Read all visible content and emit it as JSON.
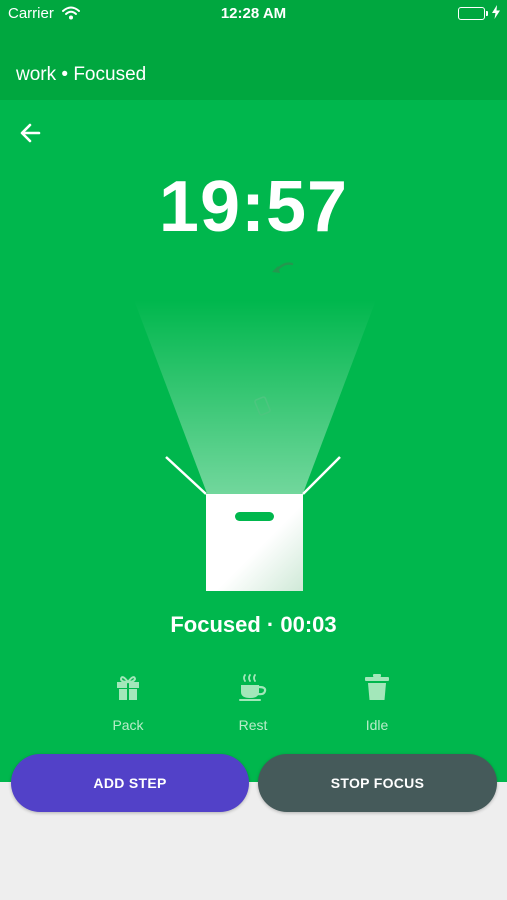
{
  "status_bar": {
    "carrier": "Carrier",
    "time": "12:28 AM"
  },
  "header": {
    "title": "work • Focused"
  },
  "timer": {
    "display": "19:57"
  },
  "session": {
    "status": "Focused · 00:03"
  },
  "actions": [
    {
      "label": "Pack",
      "icon": "gift-icon"
    },
    {
      "label": "Rest",
      "icon": "coffee-cup-icon"
    },
    {
      "label": "Idle",
      "icon": "trash-icon"
    }
  ],
  "buttons": {
    "add_step": "ADD STEP",
    "stop_focus": "STOP FOCUS"
  },
  "colors": {
    "status_bar": "#00a73f",
    "header": "#00a73f",
    "background": "#00b74d",
    "add_step_button": "#5241c8",
    "stop_focus_button": "#455a5a",
    "footer": "#eeeeee"
  }
}
